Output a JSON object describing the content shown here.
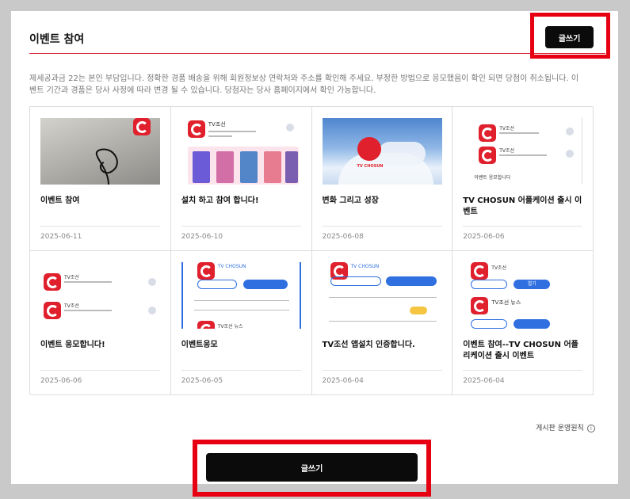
{
  "board": {
    "title": "이벤트 참여",
    "write_label": "글쓰기",
    "notice": "제세공과금 22는 본인 부담입니다. 정확한 경품 배송을 위해 회원정보상 연락처와 주소를 확인해 주세요. 부정한 방법으로 응모했음이 확인 되면 당첨이 취소됩니다. 이벤트 기간과 경품은 당사 사정에 따라 변경 될 수 있습니다. 당첨자는 당사 홈페이지에서 확인 가능합니다.",
    "rules_link": "게시판 운영원칙",
    "info_icon": "i"
  },
  "posts": [
    {
      "title": "이벤트 참여",
      "date": "2025-06-11"
    },
    {
      "title": "설치 하고 참여 합니다!",
      "date": "2025-06-10"
    },
    {
      "title": "변화 그리고 성장",
      "date": "2025-06-08"
    },
    {
      "title": "TV CHOSUN 어플케이션 출시 이벤트",
      "date": "2025-06-06"
    },
    {
      "title": "이벤트 응모합니다!",
      "date": "2025-06-06"
    },
    {
      "title": "이벤트응모",
      "date": "2025-06-05"
    },
    {
      "title": "TV조선 앱설치 인증합니다.",
      "date": "2025-06-04"
    },
    {
      "title": "이벤트 참여--TV CHOSUN 어플리케이션 출시 이벤트",
      "date": "2025-06-04"
    }
  ],
  "thumb_text": {
    "app_name": "TV조선",
    "news_name": "TV조선 뉴스",
    "chosun": "TV CHOSUN",
    "open_btn": "열기",
    "info_line": "이벤트 응모합니다",
    "tvchosun_logo": "TV CHOSUN"
  },
  "colors": {
    "accent": "#e60012",
    "brand": "#e0202c",
    "dark": "#0b0b0b",
    "blue": "#2f6fe0"
  }
}
